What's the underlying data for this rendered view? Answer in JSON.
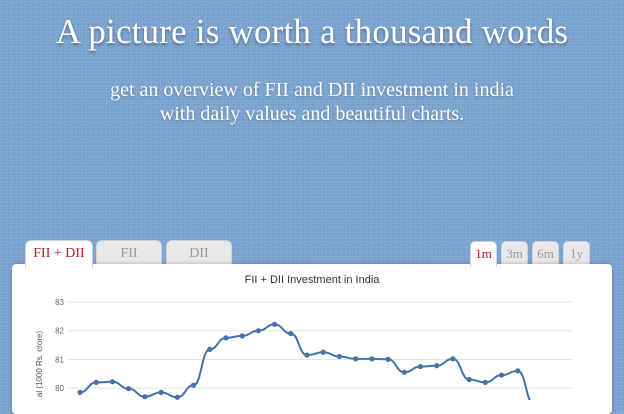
{
  "hero": {
    "title": "A picture is worth a thousand words",
    "subtitle_line1": "get an overview of FII and DII investment in india",
    "subtitle_line2": "with daily values and beautiful charts."
  },
  "tabs": [
    {
      "label": "FII + DII",
      "active": true
    },
    {
      "label": "FII",
      "active": false
    },
    {
      "label": "DII",
      "active": false
    }
  ],
  "ranges": [
    {
      "label": "1m",
      "active": true
    },
    {
      "label": "3m",
      "active": false
    },
    {
      "label": "6m",
      "active": false
    },
    {
      "label": "1y",
      "active": false
    }
  ],
  "colors": {
    "accent": "#c8102e",
    "line": "#4572a7",
    "background": "#7aa3cf"
  },
  "chart_data": {
    "type": "line",
    "title": "FII + DII Investment in India",
    "ylabel": "al (1000 Rs. crore)",
    "ylim": [
      79.6,
      83
    ],
    "yticks": [
      80,
      81,
      82,
      83
    ],
    "grid": true,
    "series": [
      {
        "values": [
          79.85,
          80.2,
          80.22,
          79.98,
          79.7,
          79.85,
          79.68,
          80.1,
          81.35,
          81.75,
          81.82,
          82.0,
          82.22,
          81.9,
          81.15,
          81.25,
          81.1,
          81.02,
          81.02,
          81.0,
          80.55,
          80.75,
          80.78,
          81.02,
          80.3,
          80.2,
          80.45,
          80.6,
          79.45
        ]
      }
    ]
  }
}
